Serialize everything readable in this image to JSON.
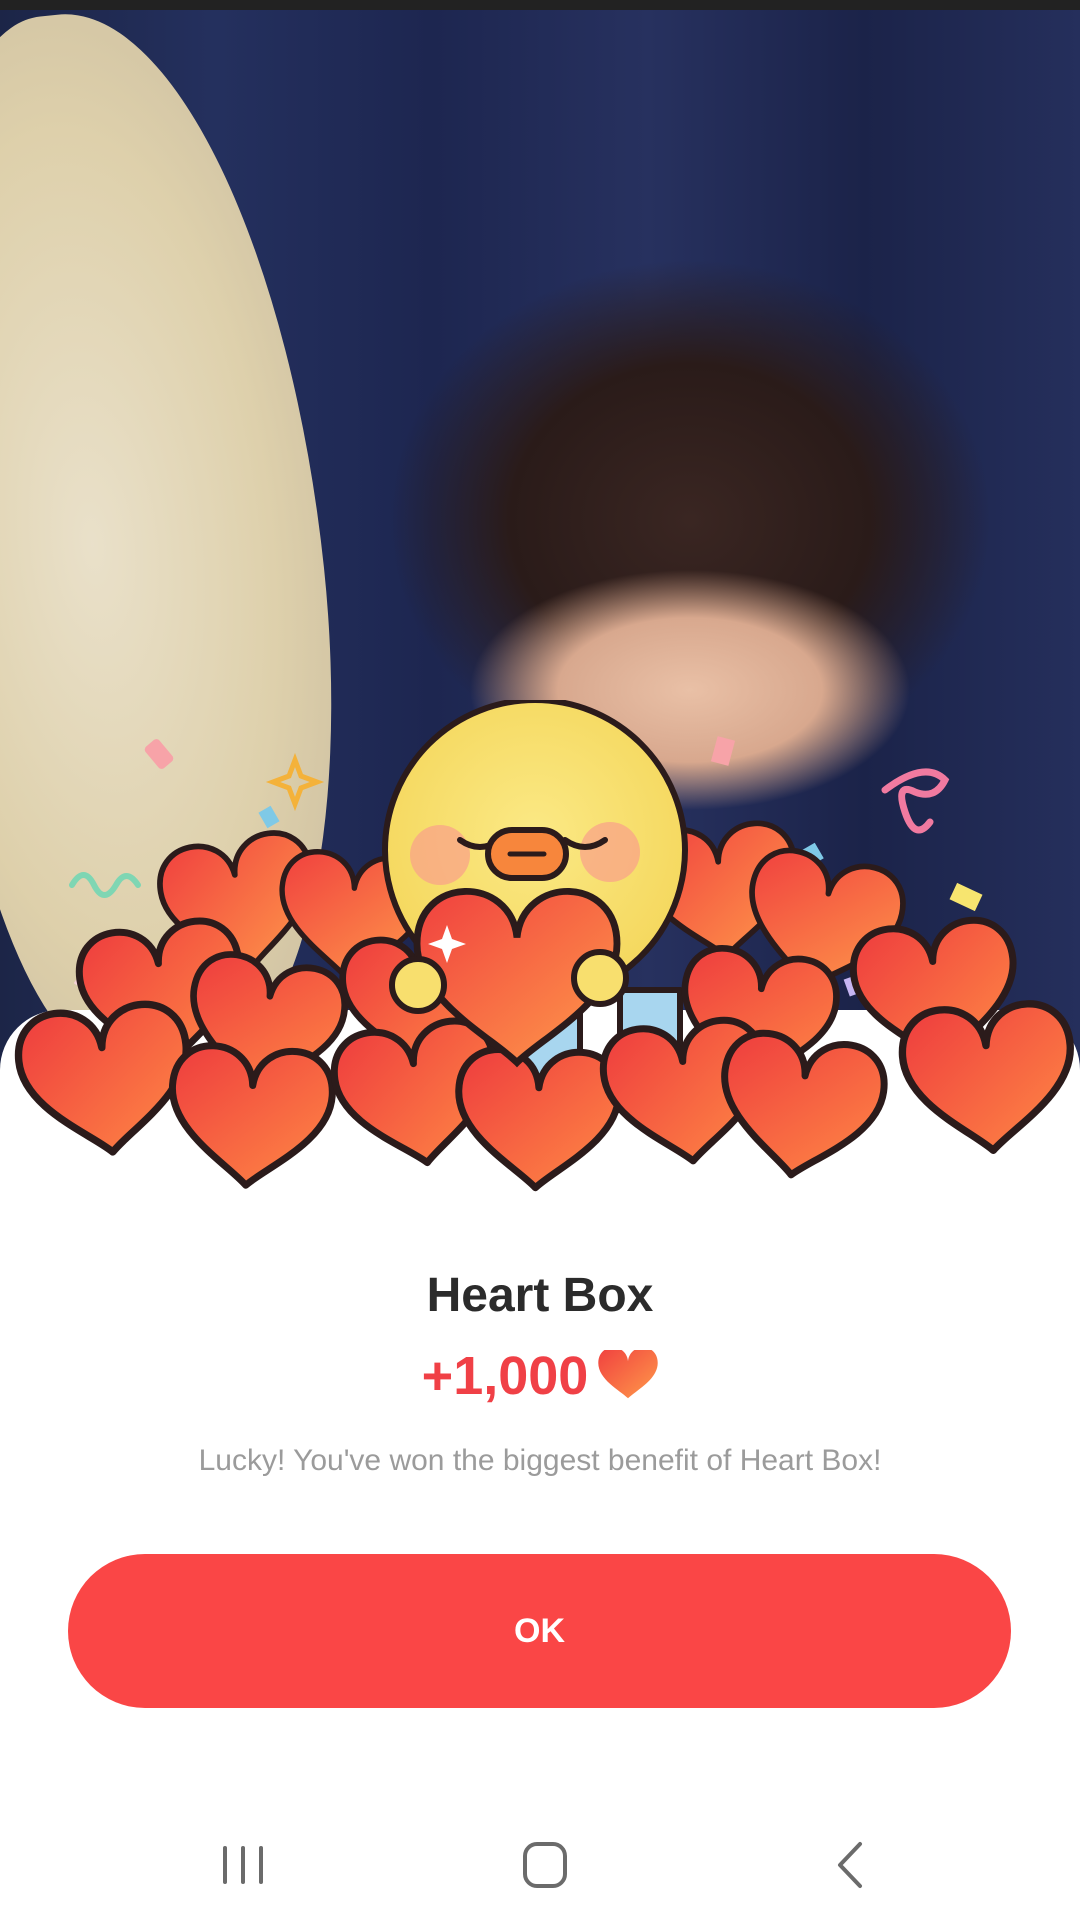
{
  "dialog": {
    "title": "Heart Box",
    "amount": "+1,000",
    "amount_icon": "heart-icon",
    "description": "Lucky! You've won the biggest benefit of Heart Box!",
    "ok_label": "OK"
  },
  "navigation": {
    "buttons": [
      "recent-apps-icon",
      "home-icon",
      "back-icon"
    ]
  },
  "colors": {
    "accent": "#fa4646",
    "amount_text": "#f04046",
    "title_text": "#2b2b2b",
    "description_text": "#9b9b9b",
    "heart_light": "#ff9a4a",
    "heart_dark": "#f0403f",
    "chick": "#f8df6e"
  }
}
